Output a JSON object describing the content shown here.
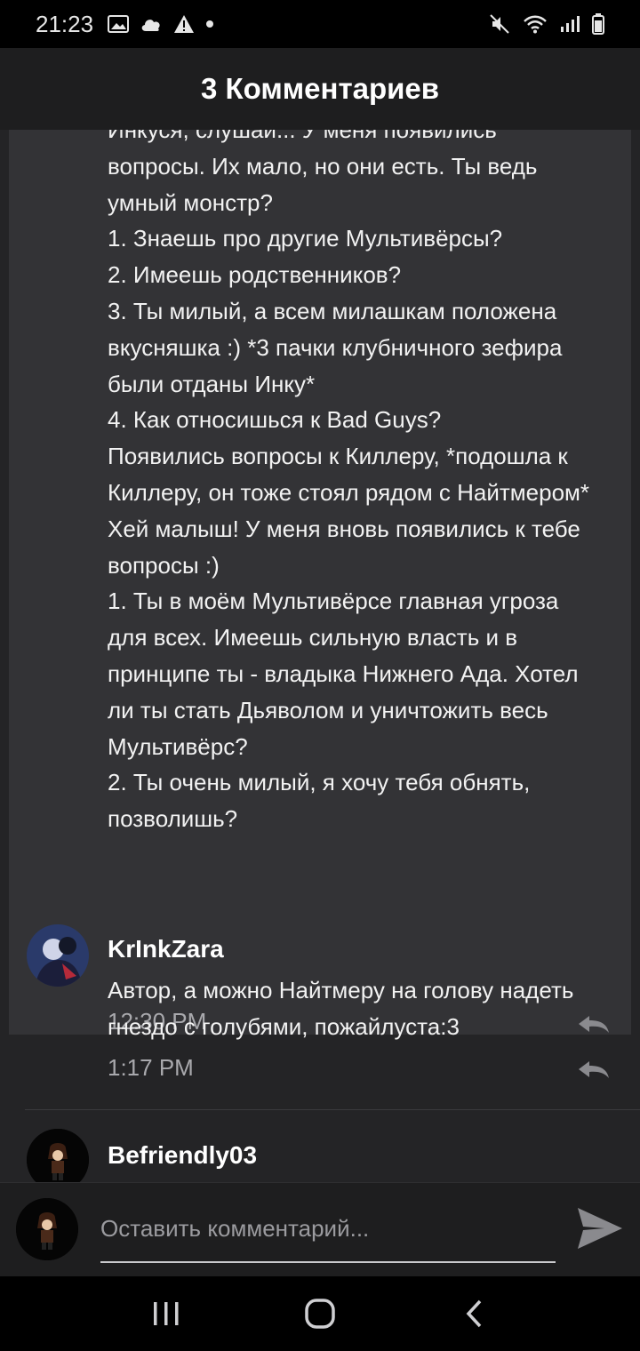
{
  "status_bar": {
    "time": "21:23",
    "icons": [
      "image-icon",
      "cloud-icon",
      "warning-icon",
      "dot-icon",
      "mute-icon",
      "wifi-icon",
      "signal-icon",
      "battery-icon"
    ]
  },
  "header": {
    "title": "3 Комментариев"
  },
  "highlighted_comment": {
    "body": "Инкуся, слушай... У меня появились\nвопросы. Их мало, но они есть. Ты ведь\nумный монстр?\n1. Знаешь про другие Мультивёрсы?\n2. Имеешь родственников?\n3. Ты милый, а всем милашкам положена\nвкусняшка :) *3 пачки клубничного зефира\nбыли отданы Инку*\n4. Как относишься к Bad Guys?\nПоявились вопросы к Киллеру, *подошла к\nКиллеру, он тоже стоял рядом с Найтмером*\nХей малыш! У меня вновь появились к тебе\nвопросы :)\n1. Ты в моём Мультивёрсе главная угроза\nдля всех. Имеешь сильную власть и в\nпринципе ты - владыка Нижнего Ада. Хотел\nли ты стать Дьяволом и уничтожить весь\nМультивёрс?\n2. Ты очень милый, я хочу тебя обнять,\nпозволишь?",
    "time": "12:30 PM"
  },
  "comments": [
    {
      "author": "KrInkZara",
      "body": "Автор, а можно Найтмеру на голову надеть\nгнездо с голубями, пожайлуста:3",
      "time": "1:17 PM"
    },
    {
      "author": "Befriendly03"
    }
  ],
  "compose": {
    "placeholder": "Оставить комментарий..."
  },
  "colors": {
    "background": "#242426",
    "highlight": "#333336",
    "header": "#1e1e1f",
    "text": "#f2f2f2",
    "muted": "#a9a9ad"
  }
}
